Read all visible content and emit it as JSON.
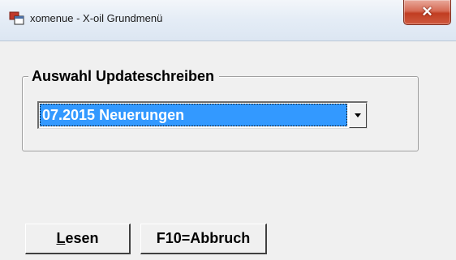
{
  "window": {
    "title": "xomenue - X-oil Grundmenü",
    "app_icon": "window-app-icon",
    "close_glyph": "✕"
  },
  "groupbox": {
    "label": "Auswahl Updateschreiben"
  },
  "combo": {
    "selected_value": "07.2015 Neuerungen",
    "arrow_icon": "chevron-down-icon"
  },
  "buttons": {
    "read": {
      "mnemonic": "L",
      "rest": "esen"
    },
    "cancel": {
      "label": "F10=Abbruch"
    }
  },
  "colors": {
    "selection": "#3399ff",
    "face": "#f0f0f0",
    "close": "#c13d21"
  }
}
